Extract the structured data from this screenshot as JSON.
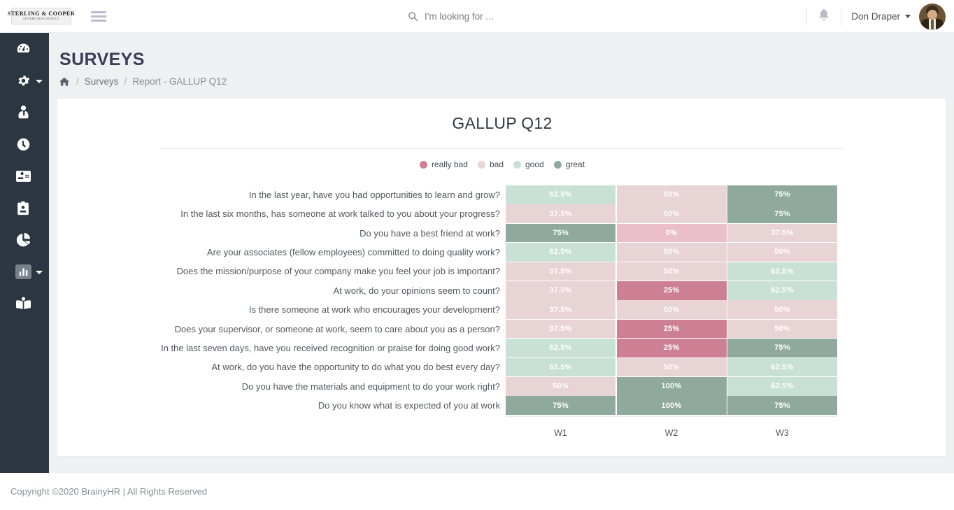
{
  "topbar": {
    "logo_line1": "STERLING & COOPER",
    "logo_line2": "ADVERTISING AGENCY",
    "menu_icon": "hamburger-icon",
    "search_placeholder": "I'm looking for ...",
    "search_value": "",
    "search_icon": "search-icon",
    "bell_icon": "bell-icon",
    "user_name": "Don Draper",
    "user_caret": "chevron-down-icon",
    "avatar": "user-avatar"
  },
  "sidebar": {
    "items": [
      {
        "icon": "dashboard-icon",
        "name": "dashboard",
        "active": false,
        "caret": false
      },
      {
        "icon": "gear-icon",
        "name": "settings",
        "active": false,
        "caret": true
      },
      {
        "icon": "user-tie-icon",
        "name": "employees",
        "active": false,
        "caret": false
      },
      {
        "icon": "clock-icon",
        "name": "time-tracking",
        "active": false,
        "caret": false
      },
      {
        "icon": "id-card-icon",
        "name": "id-card",
        "active": false,
        "caret": false
      },
      {
        "icon": "id-badge-icon",
        "name": "id-badge",
        "active": false,
        "caret": false
      },
      {
        "icon": "pie-chart-icon",
        "name": "analytics",
        "active": false,
        "caret": false
      },
      {
        "icon": "bar-chart-icon",
        "name": "surveys",
        "active": true,
        "caret": true
      },
      {
        "icon": "book-reader-icon",
        "name": "learning",
        "active": false,
        "caret": false
      }
    ]
  },
  "page": {
    "title": "SURVEYS",
    "breadcrumb": {
      "home_icon": "home-icon",
      "separator": "/",
      "link": "Surveys",
      "current": "Report - GALLUP Q12"
    }
  },
  "chart_data": {
    "type": "heatmap",
    "title": "GALLUP Q12",
    "xlabel": "",
    "ylabel": "",
    "legend_position": "top-center",
    "grid": false,
    "legend": [
      {
        "label": "really bad",
        "color": "#cd8093"
      },
      {
        "label": "bad",
        "color": "#e8d3d5"
      },
      {
        "label": "good",
        "color": "#c9e0d4"
      },
      {
        "label": "great",
        "color": "#8fa99d"
      }
    ],
    "scale": [
      {
        "label": "really bad",
        "color": "#cd8093",
        "range": "0-25"
      },
      {
        "label": "bad",
        "color": "#e8d3d5",
        "range": "37.5-50"
      },
      {
        "label": "good",
        "color": "#c9e0d4",
        "range": "62.5"
      },
      {
        "label": "great",
        "color": "#8fa99d",
        "range": "75-100"
      }
    ],
    "categories": [
      "W1",
      "W2",
      "W3"
    ],
    "rows": [
      {
        "label": "In the last year, have you had opportunities to learn and grow?",
        "cells": [
          {
            "value": "62.5%",
            "num": 62.5,
            "color": "#c9e0d4"
          },
          {
            "value": "50%",
            "num": 50,
            "color": "#e8d3d5"
          },
          {
            "value": "75%",
            "num": 75,
            "color": "#8fa99d"
          }
        ]
      },
      {
        "label": "In the last six months, has someone at work talked to you about your progress?",
        "cells": [
          {
            "value": "37.5%",
            "num": 37.5,
            "color": "#e8d3d5"
          },
          {
            "value": "50%",
            "num": 50,
            "color": "#e8d3d5"
          },
          {
            "value": "75%",
            "num": 75,
            "color": "#8fa99d"
          }
        ]
      },
      {
        "label": "Do you have a best friend at work?",
        "cells": [
          {
            "value": "75%",
            "num": 75,
            "color": "#8fa99d"
          },
          {
            "value": "0%",
            "num": 0,
            "color": "#eabfc9"
          },
          {
            "value": "37.5%",
            "num": 37.5,
            "color": "#e8d3d5"
          }
        ]
      },
      {
        "label": "Are your associates (fellow employees) committed to doing quality work?",
        "cells": [
          {
            "value": "62.5%",
            "num": 62.5,
            "color": "#c9e0d4"
          },
          {
            "value": "50%",
            "num": 50,
            "color": "#e8d3d5"
          },
          {
            "value": "50%",
            "num": 50,
            "color": "#e8d3d5"
          }
        ]
      },
      {
        "label": "Does the mission/purpose of your company make you feel your job is important?",
        "cells": [
          {
            "value": "37.5%",
            "num": 37.5,
            "color": "#e8d3d5"
          },
          {
            "value": "50%",
            "num": 50,
            "color": "#e8d3d5"
          },
          {
            "value": "62.5%",
            "num": 62.5,
            "color": "#c9e0d4"
          }
        ]
      },
      {
        "label": "At work, do your opinions seem to count?",
        "cells": [
          {
            "value": "37.5%",
            "num": 37.5,
            "color": "#e8d3d5"
          },
          {
            "value": "25%",
            "num": 25,
            "color": "#cd8093"
          },
          {
            "value": "62.5%",
            "num": 62.5,
            "color": "#c9e0d4"
          }
        ]
      },
      {
        "label": "Is there someone at work who encourages your development?",
        "cells": [
          {
            "value": "37.5%",
            "num": 37.5,
            "color": "#e8d3d5"
          },
          {
            "value": "50%",
            "num": 50,
            "color": "#e8d3d5"
          },
          {
            "value": "50%",
            "num": 50,
            "color": "#e8d3d5"
          }
        ]
      },
      {
        "label": "Does your supervisor, or someone at work, seem to care about you as a person?",
        "cells": [
          {
            "value": "37.5%",
            "num": 37.5,
            "color": "#e8d3d5"
          },
          {
            "value": "25%",
            "num": 25,
            "color": "#cd8093"
          },
          {
            "value": "50%",
            "num": 50,
            "color": "#e8d3d5"
          }
        ]
      },
      {
        "label": "In the last seven days, have you received recognition or praise for doing good work?",
        "cells": [
          {
            "value": "62.5%",
            "num": 62.5,
            "color": "#c9e0d4"
          },
          {
            "value": "25%",
            "num": 25,
            "color": "#cd8093"
          },
          {
            "value": "75%",
            "num": 75,
            "color": "#8fa99d"
          }
        ]
      },
      {
        "label": "At work, do you have the opportunity to do what you do best every day?",
        "cells": [
          {
            "value": "62.5%",
            "num": 62.5,
            "color": "#c9e0d4"
          },
          {
            "value": "50%",
            "num": 50,
            "color": "#e8d3d5"
          },
          {
            "value": "62.5%",
            "num": 62.5,
            "color": "#c9e0d4"
          }
        ]
      },
      {
        "label": "Do you have the materials and equipment to do your work right?",
        "cells": [
          {
            "value": "50%",
            "num": 50,
            "color": "#e8d3d5"
          },
          {
            "value": "100%",
            "num": 100,
            "color": "#8fa99d"
          },
          {
            "value": "62.5%",
            "num": 62.5,
            "color": "#c9e0d4"
          }
        ]
      },
      {
        "label": "Do you know what is expected of you at work",
        "cells": [
          {
            "value": "75%",
            "num": 75,
            "color": "#8fa99d"
          },
          {
            "value": "100%",
            "num": 100,
            "color": "#8fa99d"
          },
          {
            "value": "75%",
            "num": 75,
            "color": "#8fa99d"
          }
        ]
      }
    ]
  },
  "footer": {
    "text": "Copyright ©2020 BrainyHR | All Rights Reserved"
  }
}
